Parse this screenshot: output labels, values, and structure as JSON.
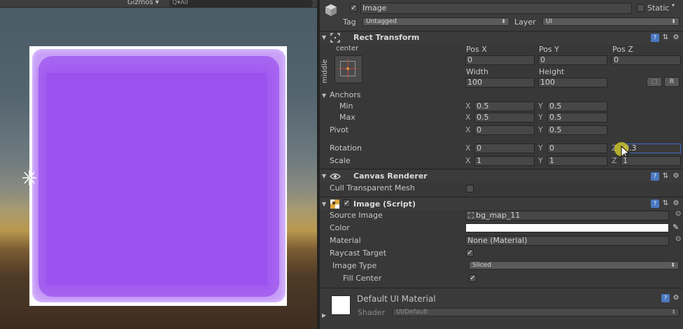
{
  "scene": {
    "gizmos_label": "Gizmos ▾",
    "search_text": "Q▾All",
    "sprite_colors": {
      "outer": "#c8a0f7",
      "mid": "#a765f0",
      "inner": "#9b52ef"
    }
  },
  "header": {
    "object_name": "Image",
    "active_checked": true,
    "static_label": "Static",
    "tag_label": "Tag",
    "tag_value": "Untagged",
    "layer_label": "Layer",
    "layer_value": "UI"
  },
  "rect_transform": {
    "title": "Rect Transform",
    "anchor_h": "center",
    "anchor_v": "middle",
    "pos_x_label": "Pos X",
    "pos_y_label": "Pos Y",
    "pos_z_label": "Pos Z",
    "pos_x": "0",
    "pos_y": "0",
    "pos_z": "0",
    "width_label": "Width",
    "height_label": "Height",
    "width": "100",
    "height": "100",
    "raw_button": "R",
    "anchors_label": "Anchors",
    "min_label": "Min",
    "max_label": "Max",
    "min_x": "0.5",
    "min_y": "0.5",
    "max_x": "0.5",
    "max_y": "0.5",
    "pivot_label": "Pivot",
    "pivot_x": "0",
    "pivot_y": "0.5",
    "rotation_label": "Rotation",
    "rot_x": "0",
    "rot_y": "0",
    "rot_z": "0.3",
    "scale_label": "Scale",
    "scale_x": "1",
    "scale_y": "1",
    "scale_z": "1",
    "x_axis": "X",
    "y_axis": "Y",
    "z_axis": "Z"
  },
  "canvas_renderer": {
    "title": "Canvas Renderer",
    "cull_label": "Cull Transparent Mesh",
    "cull_checked": false
  },
  "image_script": {
    "title": "Image (Script)",
    "source_label": "Source Image",
    "source_value": "bg_map_11",
    "color_label": "Color",
    "color_value": "#ffffff",
    "material_label": "Material",
    "material_value": "None (Material)",
    "raycast_label": "Raycast Target",
    "raycast_checked": true,
    "image_type_label": "Image Type",
    "image_type_value": "Sliced",
    "fill_center_label": "Fill Center",
    "fill_center_checked": true
  },
  "material": {
    "name": "Default UI Material",
    "shader_label": "Shader",
    "shader_value": "UI/Default"
  },
  "icons": {
    "cube": "gameobject-cube-icon",
    "rect": "rect-transform-icon",
    "eye": "canvas-renderer-eye-icon",
    "image": "image-component-icon",
    "help": "help-book-icon",
    "settings": "gear-icon"
  }
}
